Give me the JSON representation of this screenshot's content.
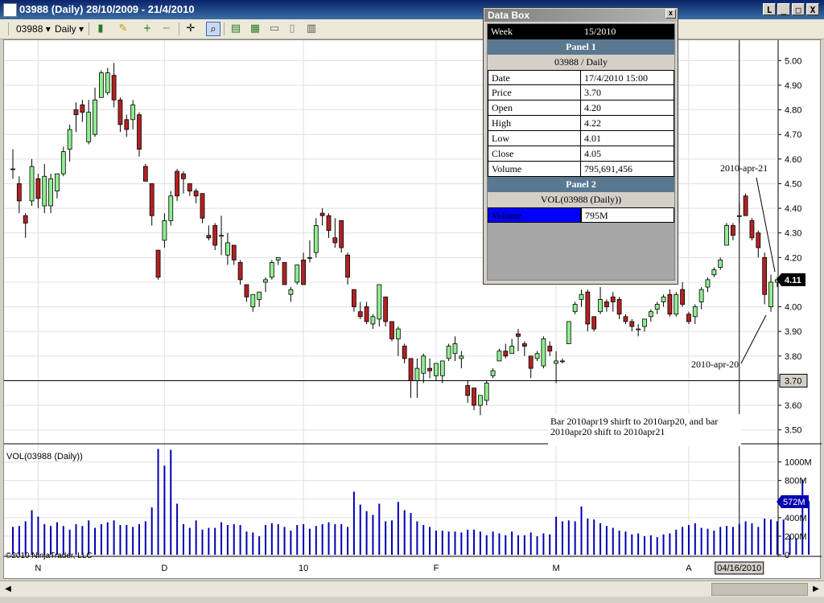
{
  "window": {
    "title": "03988 (Daily)  28/10/2009 - 21/4/2010",
    "buttons": {
      "min": "_",
      "restore": "L",
      "max": "□",
      "close": "X"
    }
  },
  "toolbar": {
    "instrument": "03988",
    "period": "Daily",
    "dropdown_glyph": "▾"
  },
  "databox": {
    "title": "Data Box",
    "close": "x",
    "week_label": "Week",
    "week_value": "15/2010",
    "panel1_label": "Panel 1",
    "panel1_series": "03988 / Daily",
    "rows": [
      {
        "label": "Date",
        "value": "17/4/2010 15:00"
      },
      {
        "label": "Price",
        "value": "3.70"
      },
      {
        "label": "Open",
        "value": "4.20"
      },
      {
        "label": "High",
        "value": "4.22"
      },
      {
        "label": "Low",
        "value": "4.01"
      },
      {
        "label": "Close",
        "value": "4.05"
      },
      {
        "label": "Volume",
        "value": "795,691,456"
      }
    ],
    "panel2_label": "Panel 2",
    "panel2_series": "VOL(03988 (Daily))",
    "volume_label": "Volume",
    "volume_value": "795M"
  },
  "chart_data": {
    "type": "candlestick",
    "price_ticks": [
      "5.00",
      "4.90",
      "4.80",
      "4.70",
      "4.60",
      "4.50",
      "4.40",
      "4.30",
      "4.20",
      "4.10",
      "4.00",
      "3.90",
      "3.80",
      "3.70",
      "3.60",
      "3.50"
    ],
    "price_range": [
      3.45,
      5.05
    ],
    "last_price_label": "4.11",
    "last_price": 4.11,
    "crosshair_price_label": "3.70",
    "crosshair_price": 3.7,
    "volume_panel_label": "VOL(03988 (Daily))",
    "volume_ticks": [
      "1000M",
      "800M",
      "600M",
      "400M",
      "200M",
      "0"
    ],
    "volume_range_millions": [
      0,
      1100
    ],
    "last_volume_label": "572M",
    "last_volume_millions": 572,
    "x_labels": [
      "N",
      "D",
      "10",
      "F",
      "M",
      "A"
    ],
    "x_label_bar_index": [
      4,
      24,
      46,
      67,
      86,
      107
    ],
    "crosshair_date_label": "04/16/2010",
    "crosshair_bar_index": 115,
    "copyright": "©2010 NinjaTrader, LLC",
    "annotations": {
      "apr21": "2010-apr-21",
      "apr20": "2010-apr-20",
      "note_line1": "Bar 2010apr19 shirft to 2010arp20,   and bar",
      "note_line2": "2010apr20 shift to 2010apr21"
    },
    "candles": [
      {
        "o": 4.56,
        "h": 4.64,
        "l": 4.52,
        "c": 4.56
      },
      {
        "o": 4.5,
        "h": 4.53,
        "l": 4.38,
        "c": 4.43
      },
      {
        "o": 4.37,
        "h": 4.38,
        "l": 4.28,
        "c": 4.34
      },
      {
        "o": 4.43,
        "h": 4.6,
        "l": 4.41,
        "c": 4.57
      },
      {
        "o": 4.52,
        "h": 4.54,
        "l": 4.4,
        "c": 4.44
      },
      {
        "o": 4.41,
        "h": 4.58,
        "l": 4.38,
        "c": 4.53
      },
      {
        "o": 4.41,
        "h": 4.54,
        "l": 4.38,
        "c": 4.52
      },
      {
        "o": 4.47,
        "h": 4.54,
        "l": 4.44,
        "c": 4.54
      },
      {
        "o": 4.54,
        "h": 4.65,
        "l": 4.53,
        "c": 4.63
      },
      {
        "o": 4.64,
        "h": 4.74,
        "l": 4.59,
        "c": 4.72
      },
      {
        "o": 4.8,
        "h": 4.83,
        "l": 4.71,
        "c": 4.78
      },
      {
        "o": 4.82,
        "h": 4.84,
        "l": 4.75,
        "c": 4.79
      },
      {
        "o": 4.67,
        "h": 4.84,
        "l": 4.66,
        "c": 4.79
      },
      {
        "o": 4.7,
        "h": 4.89,
        "l": 4.69,
        "c": 4.84
      },
      {
        "o": 4.85,
        "h": 4.96,
        "l": 4.85,
        "c": 4.95
      },
      {
        "o": 4.87,
        "h": 4.97,
        "l": 4.86,
        "c": 4.95
      },
      {
        "o": 4.94,
        "h": 4.99,
        "l": 4.81,
        "c": 4.84
      },
      {
        "o": 4.84,
        "h": 4.85,
        "l": 4.71,
        "c": 4.74
      },
      {
        "o": 4.76,
        "h": 4.78,
        "l": 4.69,
        "c": 4.72
      },
      {
        "o": 4.76,
        "h": 4.84,
        "l": 4.72,
        "c": 4.82
      },
      {
        "o": 4.78,
        "h": 4.79,
        "l": 4.61,
        "c": 4.64
      },
      {
        "o": 4.57,
        "h": 4.58,
        "l": 4.51,
        "c": 4.51
      },
      {
        "o": 4.5,
        "h": 4.5,
        "l": 4.33,
        "c": 4.37
      },
      {
        "o": 4.23,
        "h": 4.23,
        "l": 4.11,
        "c": 4.12
      },
      {
        "o": 4.27,
        "h": 4.38,
        "l": 4.24,
        "c": 4.35
      },
      {
        "o": 4.35,
        "h": 4.47,
        "l": 4.33,
        "c": 4.45
      },
      {
        "o": 4.55,
        "h": 4.56,
        "l": 4.43,
        "c": 4.45
      },
      {
        "o": 4.54,
        "h": 4.55,
        "l": 4.46,
        "c": 4.52
      },
      {
        "o": 4.5,
        "h": 4.5,
        "l": 4.45,
        "c": 4.47
      },
      {
        "o": 4.47,
        "h": 4.48,
        "l": 4.42,
        "c": 4.45
      },
      {
        "o": 4.46,
        "h": 4.46,
        "l": 4.34,
        "c": 4.36
      },
      {
        "o": 4.29,
        "h": 4.33,
        "l": 4.27,
        "c": 4.28
      },
      {
        "o": 4.33,
        "h": 4.34,
        "l": 4.23,
        "c": 4.25
      },
      {
        "o": 4.29,
        "h": 4.37,
        "l": 4.21,
        "c": 4.29
      },
      {
        "o": 4.21,
        "h": 4.3,
        "l": 4.17,
        "c": 4.26
      },
      {
        "o": 4.25,
        "h": 4.25,
        "l": 4.17,
        "c": 4.19
      },
      {
        "o": 4.18,
        "h": 4.19,
        "l": 4.09,
        "c": 4.11
      },
      {
        "o": 4.09,
        "h": 4.09,
        "l": 4.02,
        "c": 4.04
      },
      {
        "o": 4.0,
        "h": 4.05,
        "l": 3.98,
        "c": 4.05
      },
      {
        "o": 4.03,
        "h": 4.06,
        "l": 4.0,
        "c": 4.06
      },
      {
        "o": 4.1,
        "h": 4.12,
        "l": 4.06,
        "c": 4.11
      },
      {
        "o": 4.12,
        "h": 4.19,
        "l": 4.11,
        "c": 4.18
      },
      {
        "o": 4.19,
        "h": 4.2,
        "l": 4.17,
        "c": 4.2
      },
      {
        "o": 4.18,
        "h": 4.18,
        "l": 4.09,
        "c": 4.09
      },
      {
        "o": 4.05,
        "h": 4.08,
        "l": 4.02,
        "c": 4.07
      },
      {
        "o": 4.1,
        "h": 4.17,
        "l": 4.09,
        "c": 4.17
      },
      {
        "o": 4.19,
        "h": 4.22,
        "l": 4.09,
        "c": 4.09
      },
      {
        "o": 4.2,
        "h": 4.27,
        "l": 4.18,
        "c": 4.2
      },
      {
        "o": 4.22,
        "h": 4.36,
        "l": 4.2,
        "c": 4.33
      },
      {
        "o": 4.38,
        "h": 4.4,
        "l": 4.33,
        "c": 4.37
      },
      {
        "o": 4.37,
        "h": 4.38,
        "l": 4.28,
        "c": 4.31
      },
      {
        "o": 4.28,
        "h": 4.36,
        "l": 4.24,
        "c": 4.26
      },
      {
        "o": 4.35,
        "h": 4.35,
        "l": 4.22,
        "c": 4.24
      },
      {
        "o": 4.21,
        "h": 4.22,
        "l": 4.09,
        "c": 4.12
      },
      {
        "o": 4.07,
        "h": 4.07,
        "l": 3.98,
        "c": 4.0
      },
      {
        "o": 3.98,
        "h": 4.02,
        "l": 3.95,
        "c": 3.96
      },
      {
        "o": 4.0,
        "h": 4.02,
        "l": 3.93,
        "c": 3.94
      },
      {
        "o": 3.93,
        "h": 3.97,
        "l": 3.91,
        "c": 3.96
      },
      {
        "o": 3.95,
        "h": 4.09,
        "l": 3.92,
        "c": 4.09
      },
      {
        "o": 4.04,
        "h": 4.04,
        "l": 3.92,
        "c": 3.94
      },
      {
        "o": 3.94,
        "h": 3.94,
        "l": 3.86,
        "c": 3.87
      },
      {
        "o": 3.87,
        "h": 3.92,
        "l": 3.8,
        "c": 3.91
      },
      {
        "o": 3.84,
        "h": 3.85,
        "l": 3.77,
        "c": 3.79
      },
      {
        "o": 3.79,
        "h": 3.79,
        "l": 3.63,
        "c": 3.7
      },
      {
        "o": 3.7,
        "h": 3.79,
        "l": 3.63,
        "c": 3.75
      },
      {
        "o": 3.73,
        "h": 3.81,
        "l": 3.69,
        "c": 3.8
      },
      {
        "o": 3.75,
        "h": 3.79,
        "l": 3.71,
        "c": 3.74
      },
      {
        "o": 3.72,
        "h": 3.77,
        "l": 3.7,
        "c": 3.77
      },
      {
        "o": 3.72,
        "h": 3.78,
        "l": 3.69,
        "c": 3.78
      },
      {
        "o": 3.79,
        "h": 3.85,
        "l": 3.78,
        "c": 3.84
      },
      {
        "o": 3.81,
        "h": 3.88,
        "l": 3.78,
        "c": 3.85
      },
      {
        "o": 3.79,
        "h": 3.82,
        "l": 3.75,
        "c": 3.8
      },
      {
        "o": 3.68,
        "h": 3.7,
        "l": 3.61,
        "c": 3.64
      },
      {
        "o": 3.67,
        "h": 3.67,
        "l": 3.58,
        "c": 3.6
      },
      {
        "o": 3.6,
        "h": 3.64,
        "l": 3.56,
        "c": 3.64
      },
      {
        "o": 3.62,
        "h": 3.7,
        "l": 3.6,
        "c": 3.69
      },
      {
        "o": 3.72,
        "h": 3.75,
        "l": 3.71,
        "c": 3.74
      },
      {
        "o": 3.78,
        "h": 3.83,
        "l": 3.78,
        "c": 3.82
      },
      {
        "o": 3.82,
        "h": 3.85,
        "l": 3.79,
        "c": 3.8
      },
      {
        "o": 3.81,
        "h": 3.87,
        "l": 3.81,
        "c": 3.84
      },
      {
        "o": 3.89,
        "h": 3.91,
        "l": 3.82,
        "c": 3.88
      },
      {
        "o": 3.85,
        "h": 3.86,
        "l": 3.8,
        "c": 3.84
      },
      {
        "o": 3.8,
        "h": 3.8,
        "l": 3.71,
        "c": 3.75
      },
      {
        "o": 3.79,
        "h": 3.82,
        "l": 3.78,
        "c": 3.81
      },
      {
        "o": 3.76,
        "h": 3.88,
        "l": 3.75,
        "c": 3.87
      },
      {
        "o": 3.84,
        "h": 3.86,
        "l": 3.8,
        "c": 3.82
      },
      {
        "o": 3.77,
        "h": 3.82,
        "l": 3.69,
        "c": 3.78
      },
      {
        "o": 3.78,
        "h": 3.79,
        "l": 3.77,
        "c": 3.78
      },
      {
        "o": 3.85,
        "h": 3.93,
        "l": 3.85,
        "c": 3.94
      },
      {
        "o": 3.98,
        "h": 4.02,
        "l": 3.97,
        "c": 4.01
      },
      {
        "o": 4.03,
        "h": 4.07,
        "l": 4.0,
        "c": 4.05
      },
      {
        "o": 4.06,
        "h": 4.07,
        "l": 3.9,
        "c": 3.93
      },
      {
        "o": 3.96,
        "h": 3.96,
        "l": 3.9,
        "c": 3.91
      },
      {
        "o": 3.98,
        "h": 4.08,
        "l": 3.97,
        "c": 4.03
      },
      {
        "o": 4.02,
        "h": 4.03,
        "l": 3.98,
        "c": 4.0
      },
      {
        "o": 4.04,
        "h": 4.06,
        "l": 3.98,
        "c": 4.02
      },
      {
        "o": 4.03,
        "h": 4.04,
        "l": 3.95,
        "c": 3.97
      },
      {
        "o": 3.96,
        "h": 3.97,
        "l": 3.93,
        "c": 3.94
      },
      {
        "o": 3.94,
        "h": 3.95,
        "l": 3.9,
        "c": 3.92
      },
      {
        "o": 3.91,
        "h": 3.93,
        "l": 3.88,
        "c": 3.91
      },
      {
        "o": 3.92,
        "h": 3.95,
        "l": 3.9,
        "c": 3.95
      },
      {
        "o": 3.96,
        "h": 3.99,
        "l": 3.94,
        "c": 3.98
      },
      {
        "o": 3.99,
        "h": 4.02,
        "l": 3.97,
        "c": 4.01
      },
      {
        "o": 4.02,
        "h": 4.05,
        "l": 4.0,
        "c": 4.04
      },
      {
        "o": 4.05,
        "h": 4.07,
        "l": 3.96,
        "c": 3.97
      },
      {
        "o": 3.97,
        "h": 4.06,
        "l": 3.96,
        "c": 4.05
      },
      {
        "o": 4.07,
        "h": 4.1,
        "l": 4.0,
        "c": 4.01
      },
      {
        "o": 3.97,
        "h": 3.98,
        "l": 3.93,
        "c": 3.94
      },
      {
        "o": 3.96,
        "h": 4.01,
        "l": 3.93,
        "c": 4.0
      },
      {
        "o": 4.02,
        "h": 4.08,
        "l": 3.99,
        "c": 4.07
      },
      {
        "o": 4.08,
        "h": 4.12,
        "l": 4.06,
        "c": 4.11
      },
      {
        "o": 4.13,
        "h": 4.16,
        "l": 4.12,
        "c": 4.15
      },
      {
        "o": 4.16,
        "h": 4.2,
        "l": 4.15,
        "c": 4.19
      },
      {
        "o": 4.25,
        "h": 4.34,
        "l": 4.25,
        "c": 4.33
      },
      {
        "o": 4.33,
        "h": 4.34,
        "l": 4.27,
        "c": 4.29
      },
      {
        "o": 4.37,
        "h": 4.42,
        "l": 4.34,
        "c": 4.37
      },
      {
        "o": 4.45,
        "h": 4.46,
        "l": 4.37,
        "c": 4.37
      },
      {
        "o": 4.35,
        "h": 4.36,
        "l": 4.27,
        "c": 4.28
      },
      {
        "o": 4.3,
        "h": 4.31,
        "l": 4.2,
        "c": 4.24
      },
      {
        "o": 4.2,
        "h": 4.22,
        "l": 4.01,
        "c": 4.05
      },
      {
        "o": 4.0,
        "h": 4.13,
        "l": 3.98,
        "c": 4.1
      },
      {
        "o": 4.1,
        "h": 4.12,
        "l": 4.08,
        "c": 4.11
      }
    ],
    "volume_millions": [
      300,
      310,
      360,
      480,
      410,
      330,
      310,
      350,
      310,
      270,
      330,
      310,
      370,
      290,
      330,
      350,
      370,
      320,
      320,
      300,
      330,
      360,
      510,
      1140,
      960,
      1130,
      550,
      330,
      290,
      370,
      270,
      290,
      290,
      350,
      320,
      330,
      320,
      250,
      240,
      200,
      320,
      340,
      330,
      300,
      260,
      320,
      330,
      280,
      310,
      330,
      350,
      330,
      330,
      300,
      680,
      540,
      470,
      430,
      550,
      360,
      370,
      570,
      480,
      450,
      360,
      320,
      300,
      260,
      260,
      250,
      250,
      240,
      270,
      270,
      250,
      210,
      250,
      230,
      210,
      250,
      210,
      210,
      240,
      200,
      230,
      220,
      410,
      360,
      370,
      360,
      520,
      390,
      380,
      340,
      310,
      290,
      260,
      250,
      220,
      230,
      200,
      210,
      190,
      220,
      230,
      270,
      300,
      320,
      340,
      290,
      280,
      260,
      300,
      310,
      300,
      330,
      360,
      340,
      300,
      390,
      380,
      360,
      380,
      210,
      180,
      810,
      580
    ]
  }
}
